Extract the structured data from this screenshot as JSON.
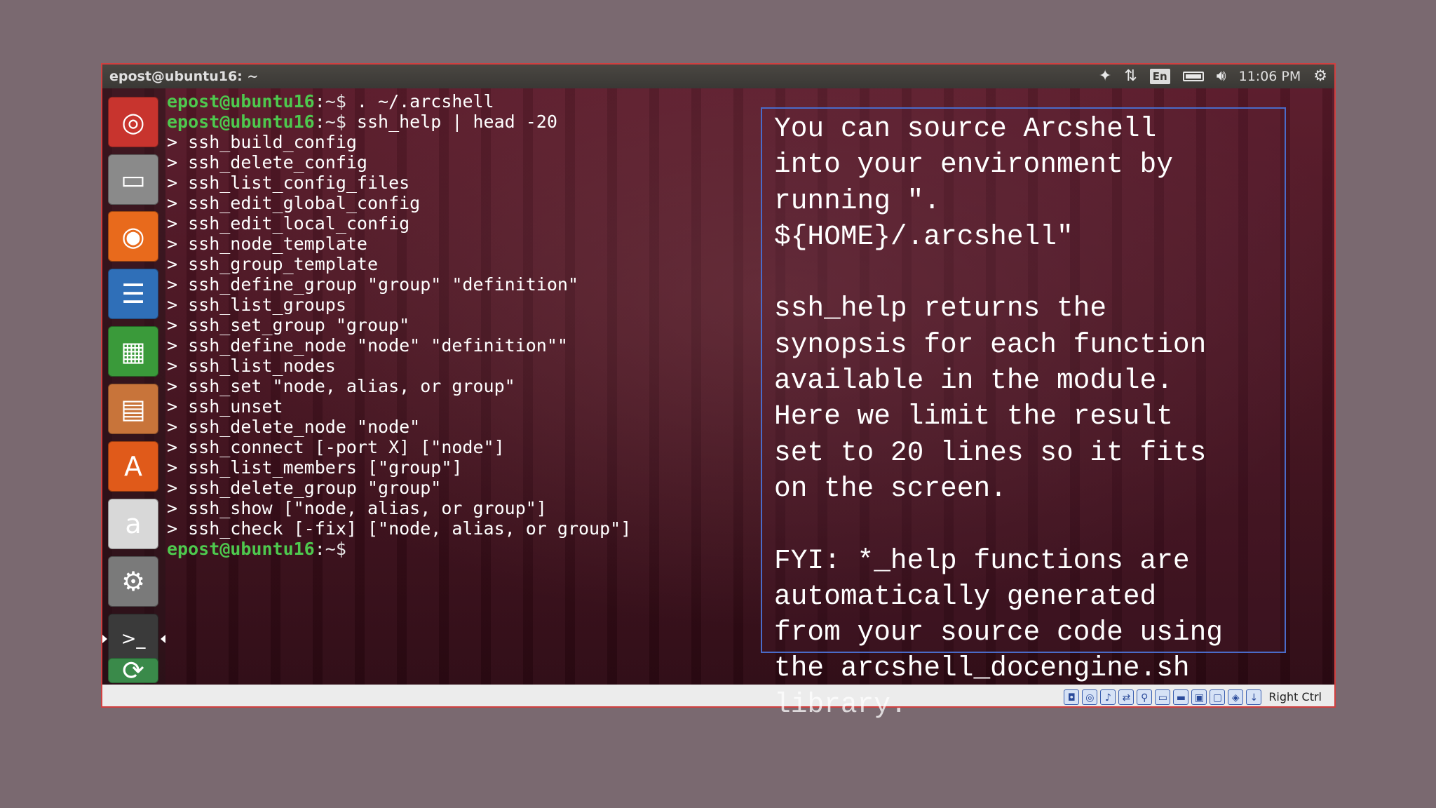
{
  "window": {
    "title": "epost@ubuntu16: ~",
    "tray": {
      "lang": "En",
      "clock": "11:06 PM"
    }
  },
  "launcher": {
    "items": [
      {
        "name": "ubuntu-dash-icon",
        "glyph": "◎",
        "color": "#c8342e"
      },
      {
        "name": "files-icon",
        "glyph": "▭",
        "color": "#8a8a8a"
      },
      {
        "name": "firefox-icon",
        "glyph": "◉",
        "color": "#e86a1c"
      },
      {
        "name": "writer-icon",
        "glyph": "☰",
        "color": "#2f6fb8"
      },
      {
        "name": "calc-icon",
        "glyph": "▦",
        "color": "#3a9a3a"
      },
      {
        "name": "impress-icon",
        "glyph": "▤",
        "color": "#c8743a"
      },
      {
        "name": "software-center-icon",
        "glyph": "A",
        "color": "#e05a1a"
      },
      {
        "name": "amazon-icon",
        "glyph": "a",
        "color": "#d8d8d8"
      },
      {
        "name": "system-settings-icon",
        "glyph": "⚙",
        "color": "#7a7a7a"
      },
      {
        "name": "terminal-icon",
        "glyph": ">_",
        "color": "#3a3a3a"
      },
      {
        "name": "software-updater-icon",
        "glyph": "⟳",
        "color": "#3a8a4a"
      }
    ]
  },
  "terminal": {
    "prompt_user": "epost@ubuntu16",
    "prompt_path": ":~$",
    "commands": [
      " . ~/.arcshell",
      " ssh_help | head -20"
    ],
    "output": [
      "> ssh_build_config",
      "> ssh_delete_config",
      "> ssh_list_config_files",
      "> ssh_edit_global_config",
      "> ssh_edit_local_config",
      "> ssh_node_template",
      "> ssh_group_template",
      "> ssh_define_group \"group\" \"definition\"",
      "> ssh_list_groups",
      "> ssh_set_group \"group\"",
      "> ssh_define_node \"node\" \"definition\"\"",
      "> ssh_list_nodes",
      "> ssh_set \"node, alias, or group\"",
      "> ssh_unset",
      "> ssh_delete_node \"node\"",
      "> ssh_connect [-port X] [\"node\"]",
      "> ssh_list_members [\"group\"]",
      "> ssh_delete_group \"group\"",
      "> ssh_show [\"node, alias, or group\"]",
      "> ssh_check [-fix] [\"node, alias, or group\"]"
    ]
  },
  "callout": {
    "lines": [
      "You can source Arcshell",
      "into your environment by",
      "running \".",
      "${HOME}/.arcshell\"",
      "",
      "ssh_help returns the",
      "synopsis for each function",
      "available in the module.",
      "Here we limit the result",
      "set to 20 lines so it fits",
      "on the screen.",
      "",
      "FYI: *_help functions are",
      "automatically generated",
      "from your source code using",
      "the arcshell_docengine.sh",
      "library."
    ]
  },
  "statusbar": {
    "hostkey": "Right Ctrl"
  }
}
